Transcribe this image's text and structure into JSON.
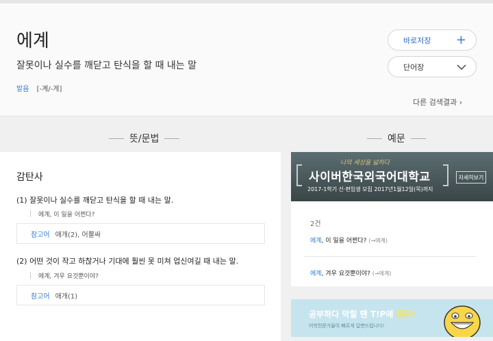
{
  "entry": {
    "word": "에계",
    "meaning": "잘못이나 실수를 깨닫고 탄식을 할 때 내는 말",
    "pron_label": "발음",
    "pron_value": "[-계/-게]"
  },
  "actions": {
    "save_label": "바로저장",
    "vocab_label": "단어장",
    "other_results": "다른 검색결과"
  },
  "sections": {
    "meaning_title": "뜻/문법",
    "example_title": "예문"
  },
  "definitions": {
    "pos": "감탄사",
    "items": [
      {
        "text": "(1)  잘못이나 실수를 깨닫고 탄식을 할 때 내는 말.",
        "example": "에계, 이 일을 어쩐다?",
        "ref_label": "참고어",
        "ref_value": "애개(2), 어뿔싸"
      },
      {
        "text": "(2)  어떤 것이 작고 하찮거나 기대에 훨씬 못 미쳐 업신여길 때 내는 말.",
        "example": "에계, 겨우 요것뿐이야?",
        "ref_label": "참고어",
        "ref_value": "애개(1)"
      }
    ]
  },
  "ad1": {
    "tagline": "나의 세상을 넓히다",
    "title": "사이버한국외국어대학교",
    "sub": "2017-1학기 신·편입생 모집  2017년1월12일(목)까지",
    "more": "자세히보기"
  },
  "examples": {
    "count": "2건",
    "items": [
      {
        "hl": "에계",
        "rest": ", 이 일을 어쩐다?",
        "src": "(→에계)"
      },
      {
        "hl": "에계",
        "rest": ", 겨우 요것뿐이야?",
        "src": "(→에계)"
      }
    ]
  },
  "ad2": {
    "title_a": "공부하다 막힐 땐 T!P에 ",
    "title_b": "질문!",
    "sub": "어학전문가들이 빠르게 답변드립니다!"
  },
  "colors": {
    "accent": "#2a7fd4",
    "bg": "#f0f0f0"
  }
}
